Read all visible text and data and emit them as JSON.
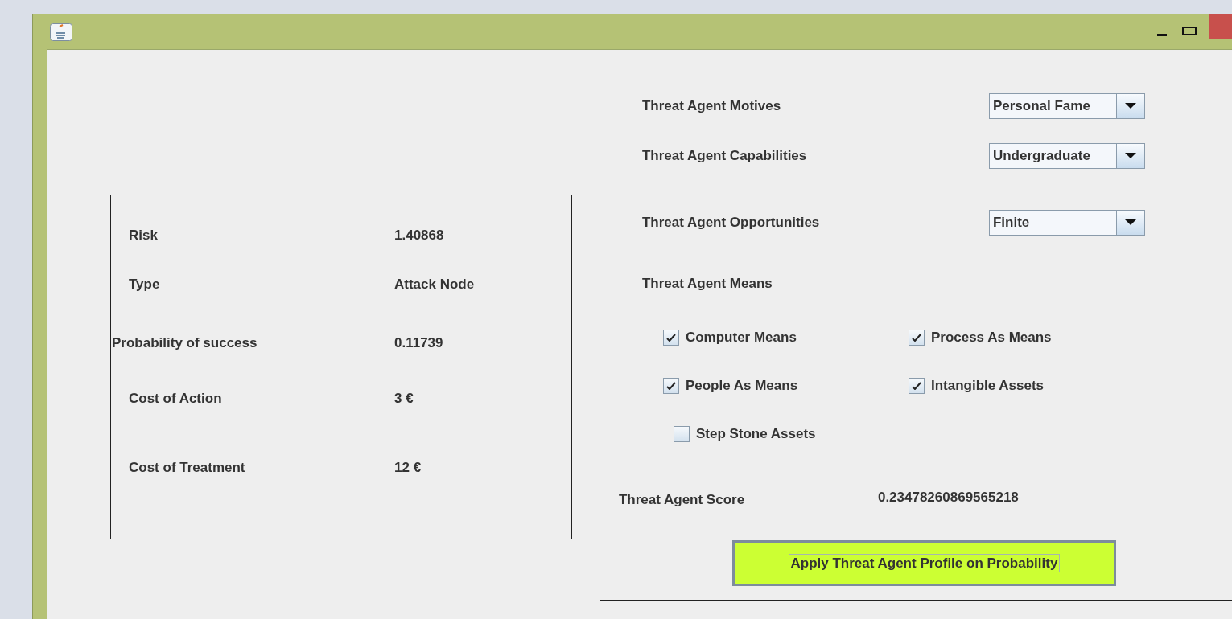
{
  "details": [
    {
      "label": "Risk",
      "value": "1.40868"
    },
    {
      "label": "Type",
      "value": "Attack Node"
    },
    {
      "label": "Probability of success",
      "value": "0.11739"
    },
    {
      "label": "Cost of Action",
      "value": "3 €"
    },
    {
      "label": "Cost of Treatment",
      "value": "12 €"
    }
  ],
  "selectors": [
    {
      "label": "Threat Agent Motives",
      "value": "Personal Fame"
    },
    {
      "label": "Threat Agent Capabilities",
      "value": "Undergraduate"
    },
    {
      "label": "Threat Agent Opportunities",
      "value": "Finite"
    }
  ],
  "means": {
    "label": "Threat Agent Means",
    "options": [
      {
        "label": "Computer Means",
        "checked": true
      },
      {
        "label": "Process As Means",
        "checked": true
      },
      {
        "label": "People As Means",
        "checked": true
      },
      {
        "label": "Intangible Assets",
        "checked": true
      },
      {
        "label": "Step Stone Assets",
        "checked": false
      }
    ]
  },
  "score": {
    "label": "Threat Agent Score",
    "value": "0.23478260869565218"
  },
  "apply_button": "Apply Threat Agent Profile on Probability"
}
